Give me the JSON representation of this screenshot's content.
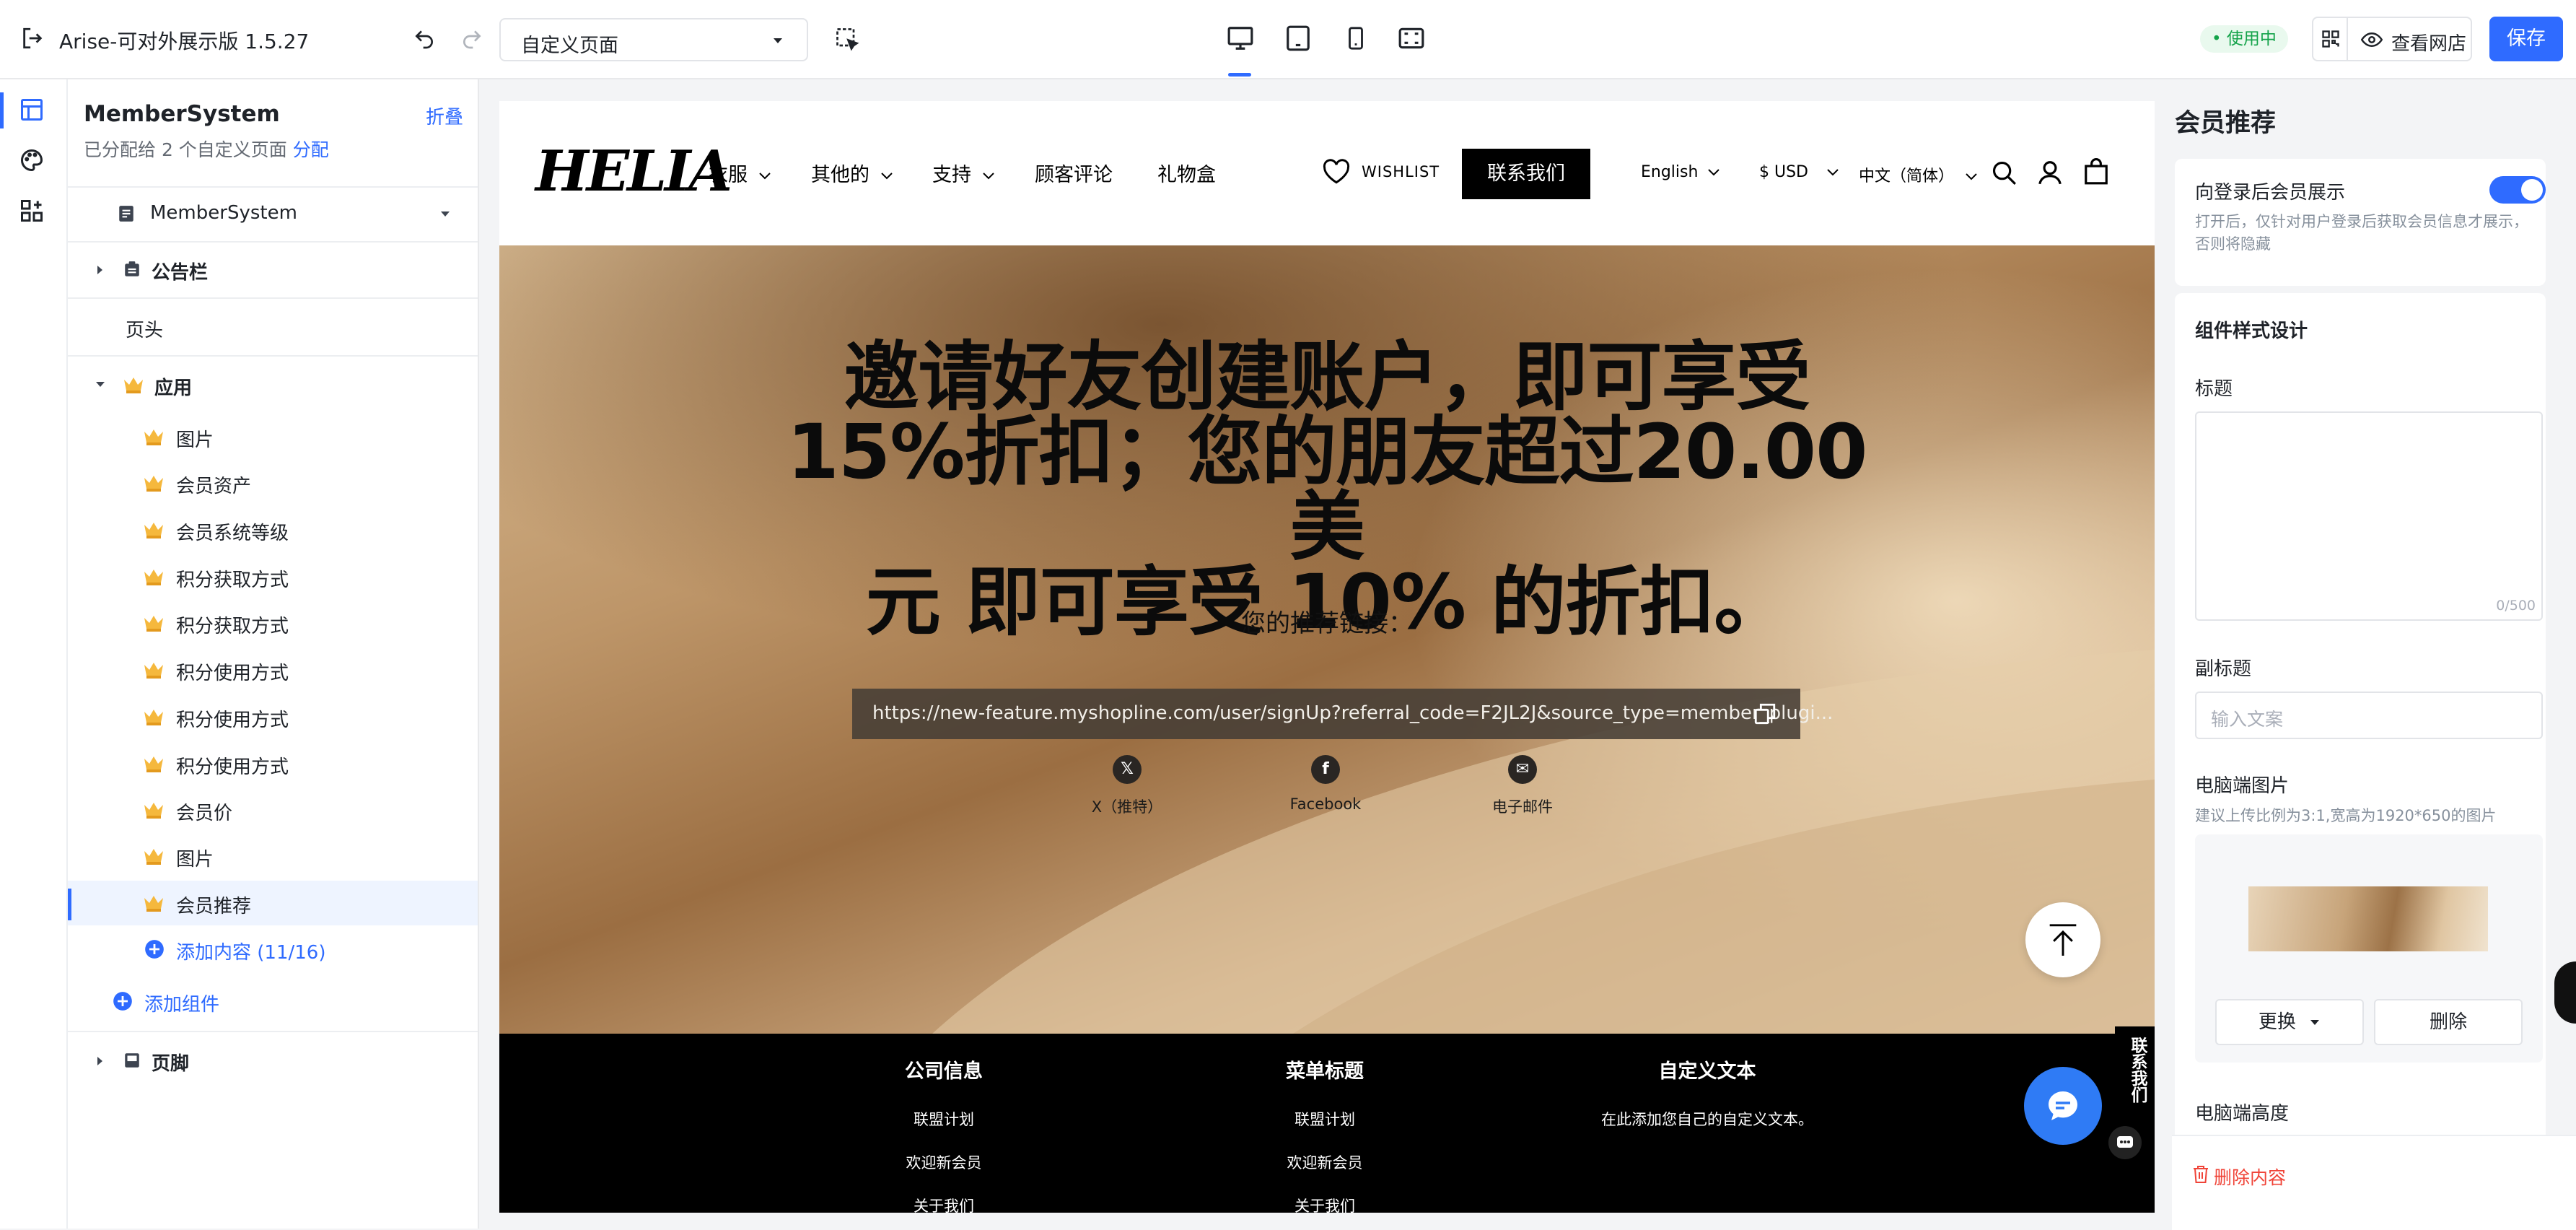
{
  "topbar": {
    "app_title": "Arise-可对外展示版 1.5.27",
    "page_select": "自定义页面",
    "status_badge": "• 使用中",
    "view_store": "查看网店",
    "save": "保存"
  },
  "tree": {
    "title": "MemberSystem",
    "fold": "折叠",
    "assigned_prefix": "已分配给 2 个自定义页面",
    "assign_link": "分配",
    "root": "MemberSystem",
    "announcement": "公告栏",
    "header": "页头",
    "app_group": "应用",
    "items": [
      "图片",
      "会员资产",
      "会员系统等级",
      "积分获取方式",
      "积分获取方式",
      "积分使用方式",
      "积分使用方式",
      "积分使用方式",
      "会员价",
      "图片",
      "会员推荐"
    ],
    "add_content": "添加内容 (11/16)",
    "add_component": "添加组件",
    "footer": "页脚"
  },
  "storefront": {
    "logo": "HELIA",
    "nav": [
      "衣服",
      "其他的",
      "支持",
      "顾客评论",
      "礼物盒"
    ],
    "wishlist": "WISHLIST",
    "contact": "联系我们",
    "language": "English",
    "currency": "$ USD",
    "locale": "中文（简体）",
    "hero_title_lines": [
      "邀请好友创建账户，即可享受",
      "15%折扣；您的朋友超过20.00美",
      "元 即可享受 10% 的折扣。"
    ],
    "referral_label": "您的推荐链接：",
    "referral_url": "https://new-feature.myshopline.com/user/signUp?referral_code=F2JL2J&source_type=member_plugi...",
    "share": [
      {
        "icon": "𝕏",
        "label": "X（推特）"
      },
      {
        "icon": "f",
        "label": "Facebook"
      },
      {
        "icon": "✉",
        "label": "电子邮件"
      }
    ],
    "footer_cols": [
      {
        "title": "公司信息",
        "links": [
          "联盟计划",
          "欢迎新会员",
          "关于我们"
        ]
      },
      {
        "title": "菜单标题",
        "links": [
          "联盟计划",
          "欢迎新会员",
          "关于我们"
        ]
      },
      {
        "title": "自定义文本",
        "links": [
          "在此添加您自己的自定义文本。"
        ]
      }
    ],
    "contact_tab": "联系我们"
  },
  "panel": {
    "title": "会员推荐",
    "toggle_label": "向登录后会员展示",
    "toggle_hint": "打开后，仅针对用户登录后获取会员信息才展示，否则将隐藏",
    "style_section": "组件样式设计",
    "title_label": "标题",
    "title_counter": "0/500",
    "subtitle_label": "副标题",
    "subtitle_placeholder": "输入文案",
    "pc_image_label": "电脑端图片",
    "pc_image_hint": "建议上传比例为3:1,宽高为1920*650的图片",
    "replace": "更换",
    "delete": "删除",
    "pc_height_label": "电脑端高度",
    "delete_content": "删除内容"
  },
  "colors": {
    "accent": "#2f6bff",
    "danger": "#f04438",
    "success": "#14a34a",
    "chat": "#2f7bf5"
  }
}
